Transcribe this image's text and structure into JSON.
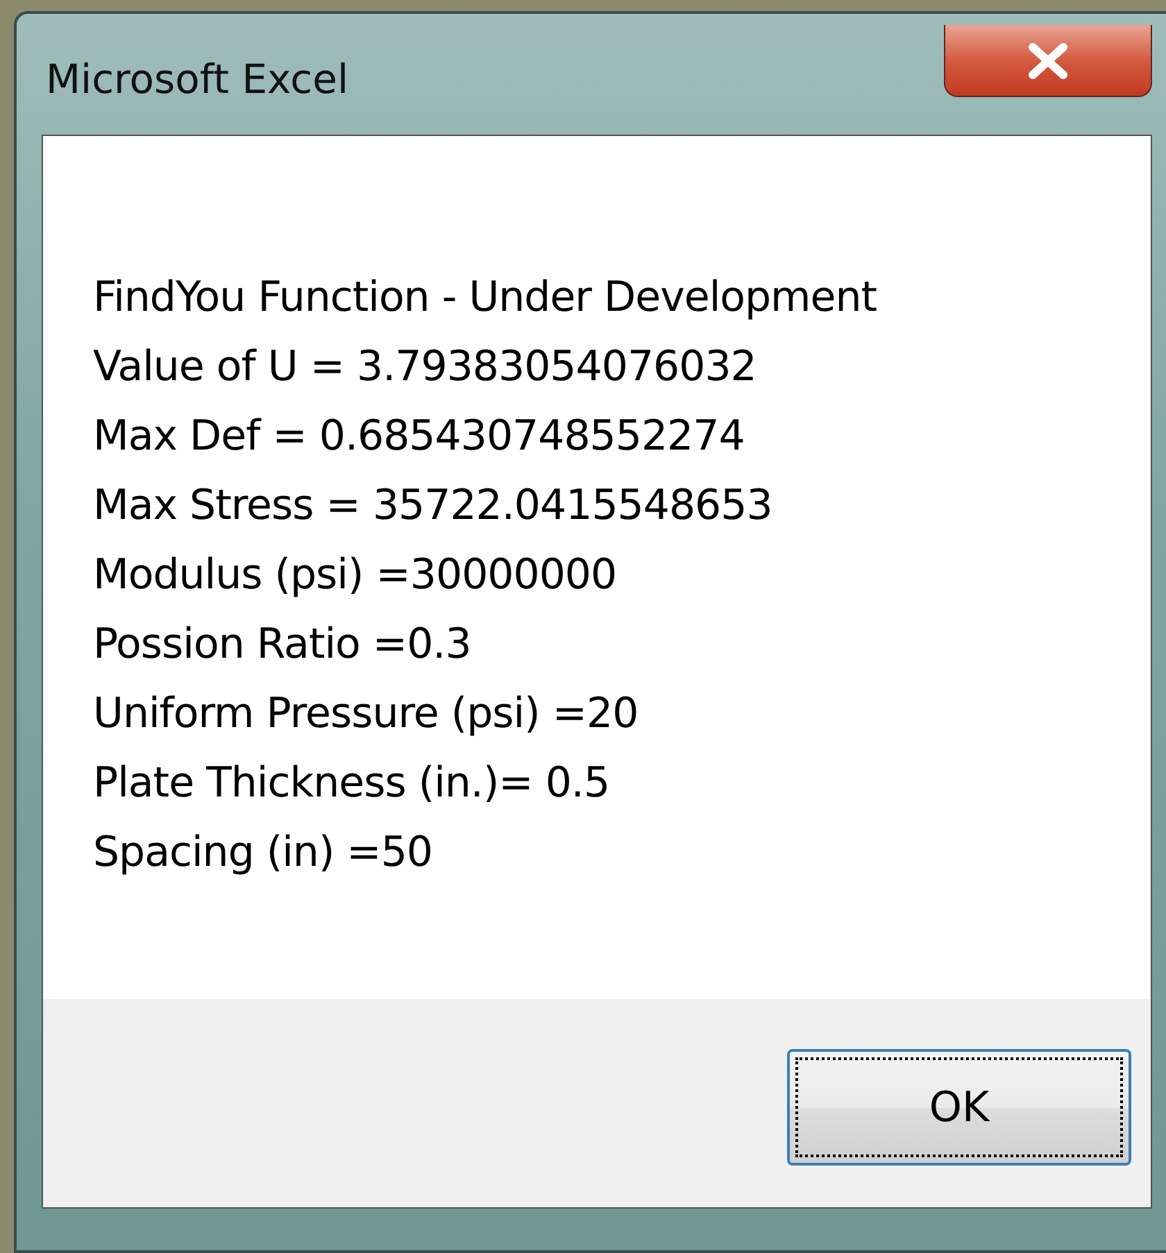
{
  "window": {
    "title": "Microsoft Excel"
  },
  "message": [
    "FindYou Function - Under Development",
    "Value of U = 3.79383054076032",
    "Max Def = 0.685430748552274",
    "Max Stress = 35722.0415548653",
    "Modulus (psi) =30000000",
    "Possion Ratio =0.3",
    "Uniform Pressure (psi) =20",
    "Plate Thickness (in.)= 0.5",
    "Spacing (in) =50"
  ],
  "buttons": [
    {
      "label": "OK",
      "focused": true
    }
  ]
}
